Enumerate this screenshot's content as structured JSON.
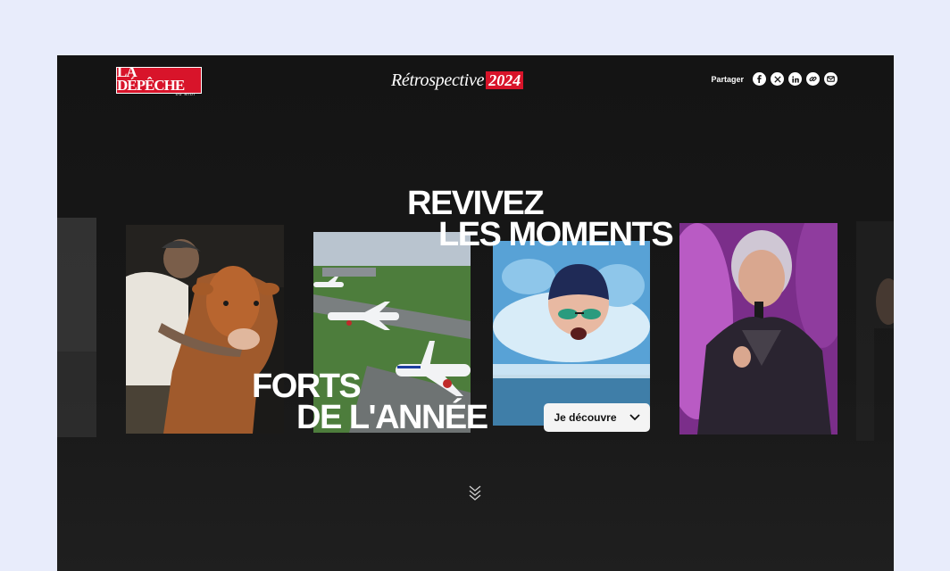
{
  "header": {
    "logo_text": "LA DÉPÊCHE",
    "logo_subtext": "DU MIDI",
    "title_word": "Rétrospective",
    "title_year": "2024",
    "share_label": "Partager",
    "social_icons": [
      "facebook-icon",
      "x-icon",
      "linkedin-icon",
      "link-icon",
      "email-icon"
    ]
  },
  "hero": {
    "line1": "REVIVEZ",
    "line2": "LES MOMENTS",
    "line3": "FORTS",
    "line4": "DE L'ANNÉE",
    "cta_label": "Je découvre",
    "cards": [
      "cow-photo",
      "airplanes-photo",
      "swimmer-photo",
      "singer-photo"
    ]
  },
  "colors": {
    "brand_red": "#d8142a",
    "background": "#141414",
    "page_bg": "#e8ecfb",
    "cta_bg": "#f4f4f4"
  }
}
